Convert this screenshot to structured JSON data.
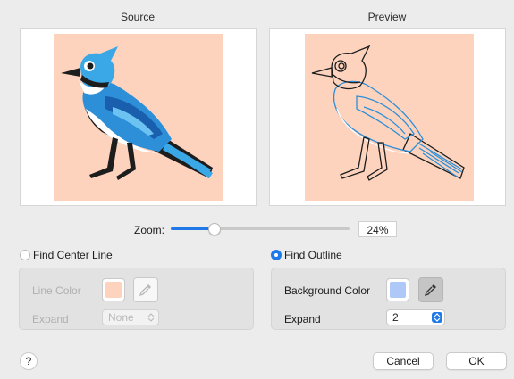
{
  "source": {
    "label": "Source"
  },
  "preview": {
    "label": "Preview"
  },
  "zoom": {
    "label": "Zoom:",
    "value": "24%",
    "fraction": 0.24
  },
  "center_line": {
    "label": "Find Center Line",
    "selected": false,
    "line_color_label": "Line Color",
    "line_color": "#fdd3bd",
    "expand_label": "Expand",
    "expand_value": "None"
  },
  "outline": {
    "label": "Find Outline",
    "selected": true,
    "bg_color_label": "Background Color",
    "bg_color": "#aec8f7",
    "expand_label": "Expand",
    "expand_value": "2"
  },
  "buttons": {
    "help": "?",
    "cancel": "Cancel",
    "ok": "OK"
  },
  "colors": {
    "accent": "#1f7ae8",
    "image_bg": "#fdd3bd"
  }
}
